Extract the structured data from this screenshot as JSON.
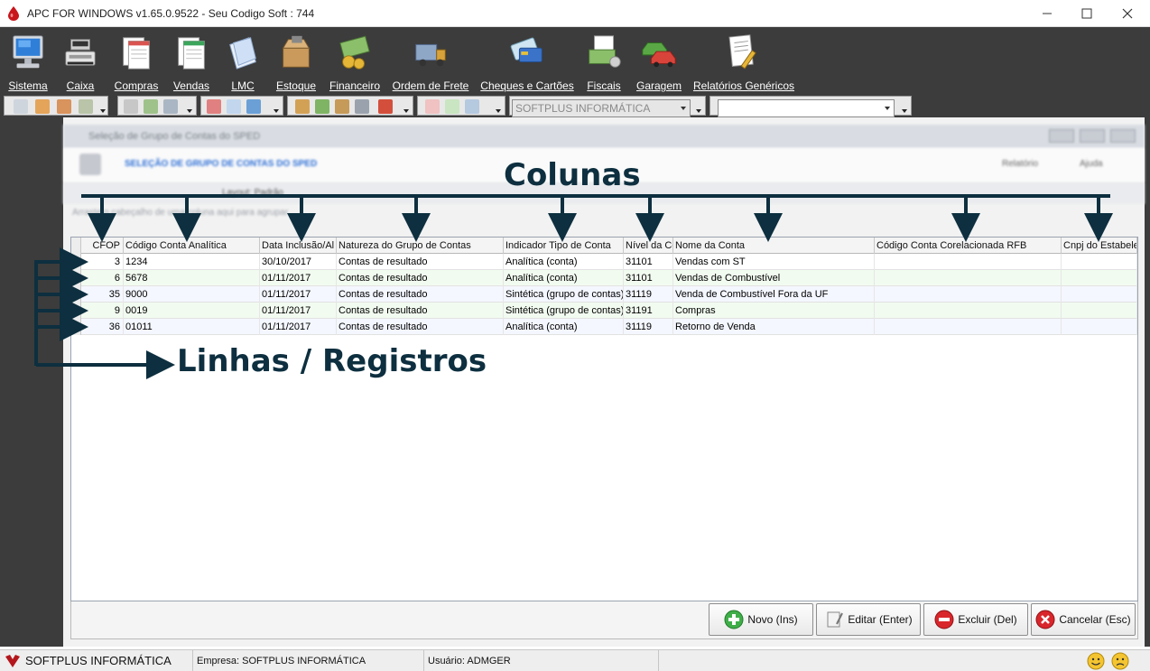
{
  "window": {
    "title": "APC FOR WINDOWS v1.65.0.9522 - Seu Codigo Soft : 744"
  },
  "menu": {
    "items": [
      {
        "label": "Sistema",
        "icon": "computer-monitor-icon"
      },
      {
        "label": "Caixa",
        "icon": "cash-register-icon"
      },
      {
        "label": "Compras",
        "icon": "purchase-documents-icon"
      },
      {
        "label": "Vendas",
        "icon": "sales-documents-icon"
      },
      {
        "label": "LMC",
        "icon": "lmc-sheets-icon"
      },
      {
        "label": "Estoque",
        "icon": "stock-box-icon"
      },
      {
        "label": "Financeiro",
        "icon": "money-coins-icon"
      },
      {
        "label": "Ordem de Frete",
        "icon": "freight-truck-icon"
      },
      {
        "label": "Cheques e Cartões",
        "icon": "cards-cheques-icon"
      },
      {
        "label": "Fiscais",
        "icon": "fiscal-money-icon"
      },
      {
        "label": "Garagem",
        "icon": "cars-garage-icon"
      },
      {
        "label": "Relatórios Genéricos",
        "icon": "reports-pencil-icon"
      }
    ]
  },
  "toolbar": {
    "company_combo": "SOFTPLUS INFORMÁTICA",
    "second_combo": ""
  },
  "dialog": {
    "title": "Seleção de Grupo de Contas do SPED",
    "header": "SELEÇÃO DE GRUPO DE CONTAS DO SPED",
    "relatorio_label": "Relatório",
    "ajuda_label": "Ajuda",
    "filter_label": "Layout: Padrão",
    "group_hint": "Arraste o cabeçalho de uma coluna aqui para agrupar"
  },
  "grid": {
    "columns": [
      "CFOP",
      "Código Conta Analítica",
      "Data Inclusão/Al",
      "Natureza do Grupo de Contas",
      "Indicador Tipo de Conta",
      "Nível da Co",
      "Nome da Conta",
      "Código Conta Corelacionada RFB",
      "Cnpj do Estabele"
    ],
    "rows": [
      [
        "3",
        "1234",
        "30/10/2017",
        "Contas de resultado",
        "Analítica (conta)",
        "31101",
        "Vendas com ST",
        "",
        ""
      ],
      [
        "6",
        "5678",
        "01/11/2017",
        "Contas de resultado",
        "Analítica (conta)",
        "31101",
        "Vendas de Combustível",
        "",
        ""
      ],
      [
        "35",
        "9000",
        "01/11/2017",
        "Contas de resultado",
        "Sintética (grupo de contas)",
        "31119",
        "Venda de Combustível Fora da UF",
        "",
        ""
      ],
      [
        "9",
        "0019",
        "01/11/2017",
        "Contas de resultado",
        "Sintética (grupo de contas)",
        "31191",
        "Compras",
        "",
        ""
      ],
      [
        "36",
        "01011",
        "01/11/2017",
        "Contas de resultado",
        "Analítica (conta)",
        "31119",
        "Retorno de Venda",
        "",
        ""
      ]
    ]
  },
  "buttons": {
    "novo": "Novo (Ins)",
    "editar": "Editar (Enter)",
    "excluir": "Excluir (Del)",
    "cancelar": "Cancelar (Esc)"
  },
  "status": {
    "brand": "SOFTPLUS INFORMÁTICA",
    "empresa": "Empresa: SOFTPLUS INFORMÁTICA",
    "usuario": "Usuário: ADMGER"
  },
  "annotations": {
    "columns_label": "Colunas",
    "rows_label": "Linhas / Registros",
    "color": "#0d2f3f"
  }
}
